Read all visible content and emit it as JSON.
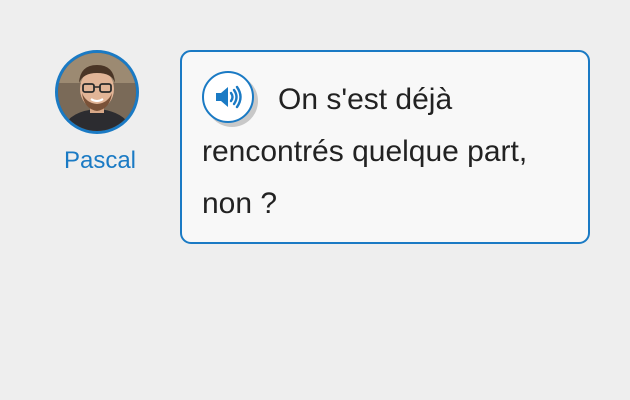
{
  "speaker": {
    "name": "Pascal",
    "avatar_icon": "person-photo"
  },
  "bubble": {
    "text": "On s'est déjà rencontrés quelque part, non ?",
    "audio_icon": "speaker-icon"
  },
  "colors": {
    "accent": "#1a7ac4",
    "background": "#eeeeee",
    "bubble_background": "#f8f8f8",
    "text": "#222222"
  }
}
